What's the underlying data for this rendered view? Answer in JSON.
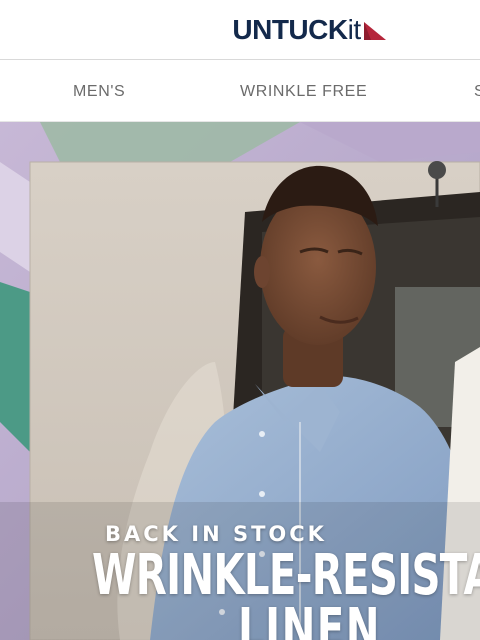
{
  "header": {
    "logo_upper": "UNTUCK",
    "logo_lower": "it",
    "logo_color": "#13294b",
    "logo_flag_color": "#b5263b"
  },
  "nav": {
    "items": [
      {
        "label": "MEN'S"
      },
      {
        "label": "WRINKLE FREE"
      },
      {
        "label": "S"
      }
    ]
  },
  "hero": {
    "eyebrow": "BACK IN STOCK",
    "title_line1": "WRINKLE-RESISTANT",
    "title_line2": "LINEN"
  }
}
